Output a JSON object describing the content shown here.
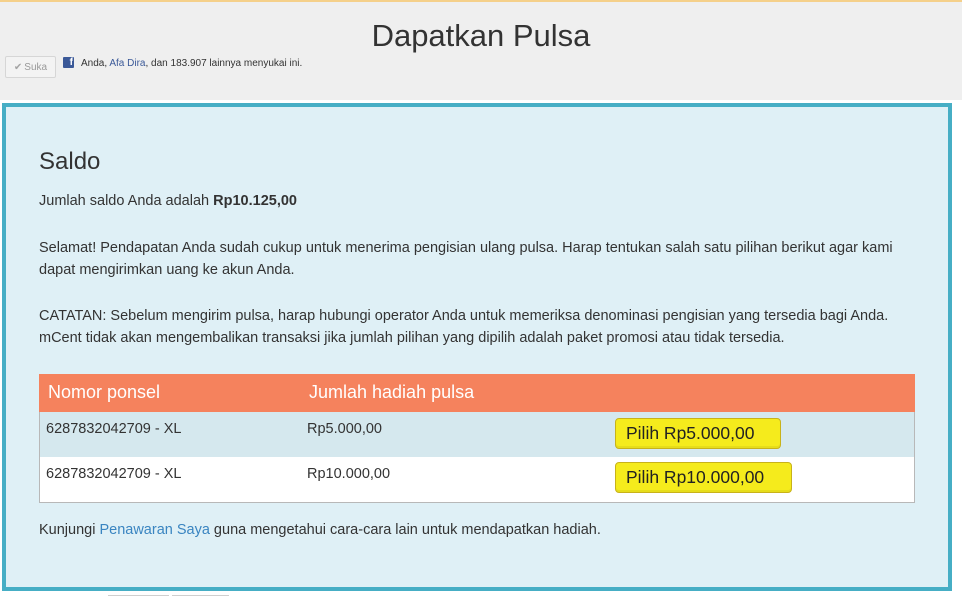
{
  "header": {
    "title": "Dapatkan Pulsa",
    "like_button": "Suka",
    "like_text_prefix": "Anda, ",
    "like_text_name": "Afa Dira",
    "like_text_suffix": ", dan 183.907 lainnya menyukai ini."
  },
  "balance": {
    "heading": "Saldo",
    "label": "Jumlah saldo Anda adalah ",
    "amount": "Rp10.125,00",
    "congrats": "Selamat! Pendapatan Anda sudah cukup untuk menerima pengisian ulang pulsa. Harap tentukan salah satu pilihan berikut agar kami dapat mengirimkan uang ke akun Anda.",
    "note": "CATATAN: Sebelum mengirim pulsa, harap hubungi operator Anda untuk memeriksa denominasi pengisian yang tersedia bagi Anda. mCent tidak akan mengembalikan transaksi jika jumlah pilihan yang dipilih adalah paket promosi atau tidak tersedia."
  },
  "table": {
    "col_phone": "Nomor ponsel",
    "col_amount": "Jumlah hadiah pulsa",
    "rows": [
      {
        "phone": "6287832042709 - XL",
        "amount": "Rp5.000,00",
        "button": "Pilih Rp5.000,00"
      },
      {
        "phone": "6287832042709 - XL",
        "amount": "Rp10.000,00",
        "button": "Pilih Rp10.000,00"
      }
    ]
  },
  "footer": {
    "visit_prefix": "Kunjungi ",
    "visit_link": "Penawaran Saya",
    "visit_suffix": " guna mengetahui cara-cara lain untuk mendapatkan hadiah."
  },
  "colors": {
    "panel_border": "#46aec5",
    "panel_bg": "#dff0f6",
    "table_header": "#f5825d",
    "button_yellow": "#f5eb1c",
    "link": "#3a85c1"
  }
}
